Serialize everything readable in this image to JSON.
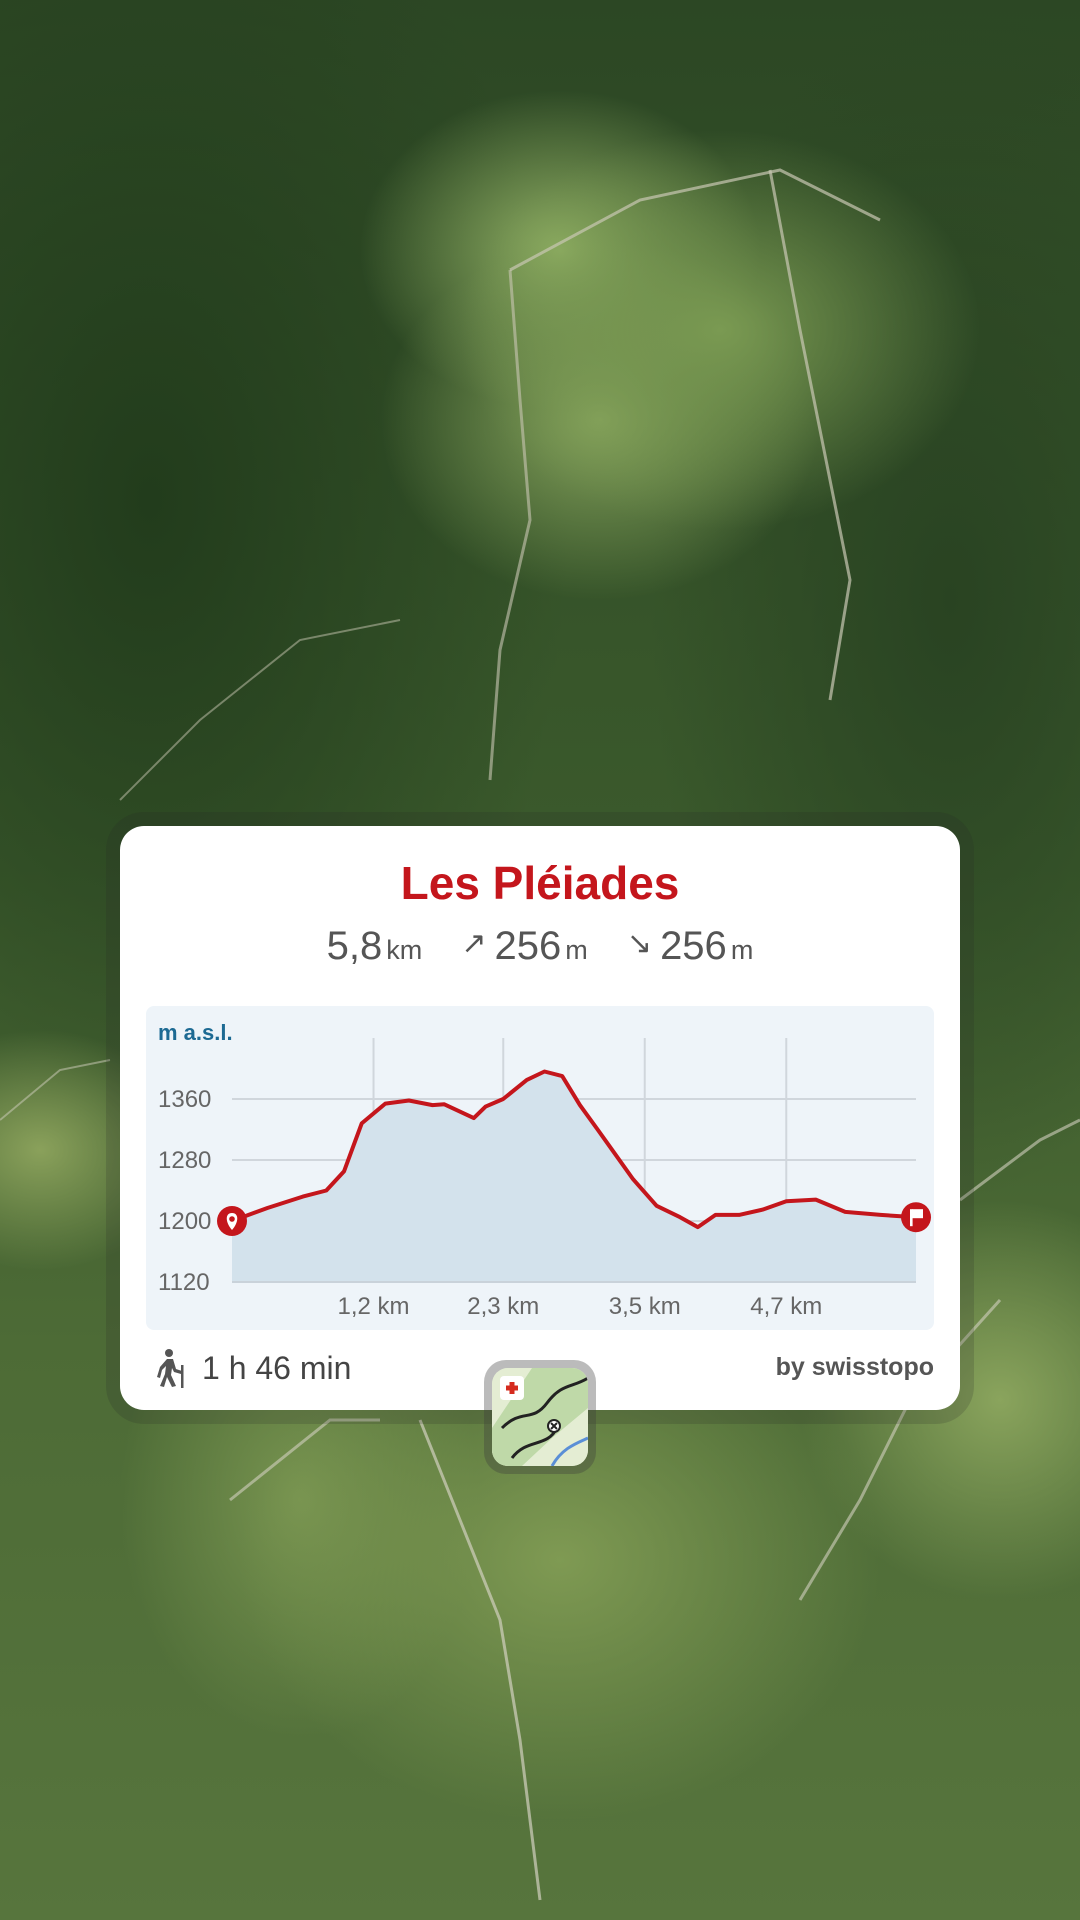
{
  "route": {
    "name": "Les Pléiades",
    "distance_value": "5,8",
    "distance_unit": "km",
    "ascent_arrow": "↗",
    "ascent_value": "256",
    "ascent_unit": "m",
    "descent_arrow": "↘",
    "descent_value": "256",
    "descent_unit": "m",
    "duration": "1 h 46 min",
    "credit": "by swisstopo"
  },
  "colors": {
    "accent": "#c4161c",
    "profile_fill": "#d3e2ec",
    "axis_label": "#1d6a93"
  },
  "chart_data": {
    "type": "area",
    "ylabel": "m a.s.l.",
    "yticks": [
      1120,
      1200,
      1280,
      1360
    ],
    "ylim": [
      1120,
      1440
    ],
    "xlim": [
      0,
      5.8
    ],
    "xticks": [
      1.2,
      2.3,
      3.5,
      4.7
    ],
    "xtick_labels": [
      "1,2 km",
      "2,3 km",
      "3,5 km",
      "4,7 km"
    ],
    "grid": true,
    "start_marker": "map-pin-icon",
    "end_marker": "flag-icon",
    "series": [
      {
        "x": [
          0,
          0.3,
          0.6,
          0.8,
          0.95,
          1.1,
          1.3,
          1.5,
          1.7,
          1.8,
          2.05,
          2.15,
          2.3,
          2.5,
          2.65,
          2.8,
          2.95,
          3.1,
          3.4,
          3.6,
          3.8,
          3.95,
          4.1,
          4.3,
          4.5,
          4.7,
          4.95,
          5.2,
          5.5,
          5.8
        ],
        "y": [
          1200,
          1217,
          1232,
          1240,
          1265,
          1328,
          1354,
          1358,
          1352,
          1353,
          1335,
          1350,
          1360,
          1385,
          1396,
          1390,
          1352,
          1320,
          1255,
          1220,
          1205,
          1192,
          1208,
          1208,
          1215,
          1226,
          1228,
          1212,
          1208,
          1205
        ]
      }
    ]
  }
}
